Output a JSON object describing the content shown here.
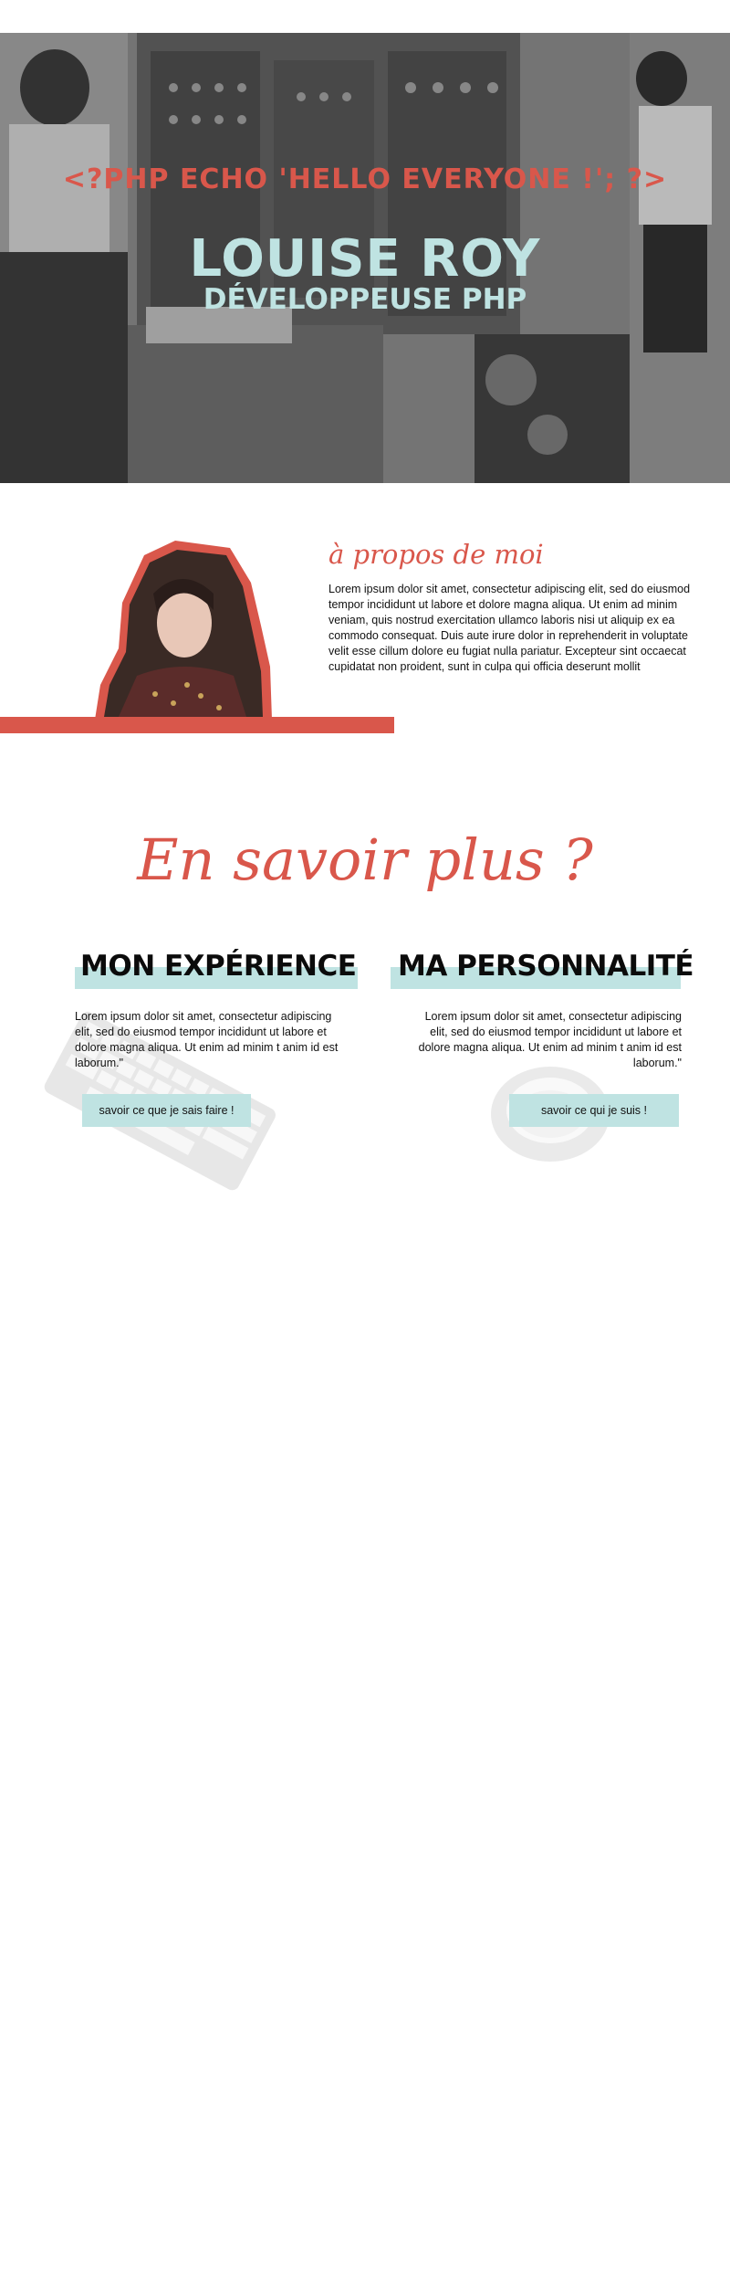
{
  "hero": {
    "code_line": "<?PHP ECHO 'HELLO EVERYONE !'; ?>",
    "name": "LOUISE ROY",
    "role": "DÉVELOPPEUSE PHP"
  },
  "about": {
    "title": "à propos de moi",
    "text": "Lorem ipsum dolor sit amet, consectetur adipiscing elit, sed do eiusmod tempor incididunt ut labore et dolore magna aliqua. Ut enim ad minim veniam, quis nostrud exercitation ullamco laboris nisi ut aliquip ex ea commodo consequat. Duis aute irure dolor in reprehenderit in voluptate velit esse cillum dolore eu fugiat nulla pariatur. Excepteur sint occaecat cupidatat non proident, sunt in culpa qui officia deserunt mollit"
  },
  "more": {
    "title": "En savoir plus ?",
    "experience": {
      "heading": "MON EXPÉRIENCE",
      "text": "Lorem ipsum dolor sit amet, consectetur adipiscing elit, sed do eiusmod tempor incididunt ut labore et dolore magna aliqua. Ut enim ad minim t anim id est laborum.\"",
      "button": "savoir ce que je sais faire !"
    },
    "personality": {
      "heading": "MA PERSONNALITÉ",
      "text": "Lorem ipsum dolor sit amet, consectetur adipiscing elit, sed do eiusmod tempor incididunt ut labore et dolore magna aliqua. Ut enim ad minim t anim id est laborum.\"",
      "button": "savoir ce qui je suis !"
    }
  },
  "colors": {
    "accent_red": "#d9574b",
    "accent_teal": "#bfe3e2"
  }
}
